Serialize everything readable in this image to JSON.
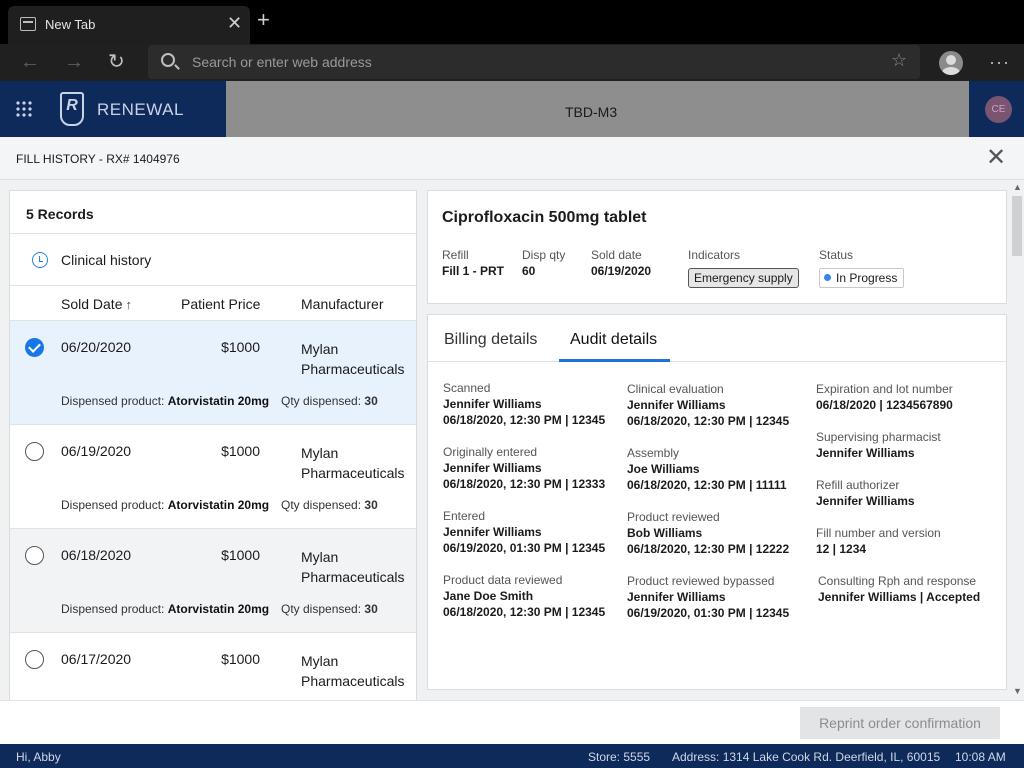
{
  "browser": {
    "tab_title": "New Tab",
    "address_placeholder": "Search or enter web address"
  },
  "app": {
    "brand": "RENEWAL",
    "logo_letter": "R",
    "store_code": "TBD-M3",
    "user_initials": "CE"
  },
  "dialog": {
    "title": "FILL HISTORY - RX# 1404976"
  },
  "left": {
    "records": "5 Records",
    "clinical_history": "Clinical history",
    "columns": {
      "sold_date": "Sold Date",
      "patient_price": "Patient Price",
      "manufacturer": "Manufacturer"
    },
    "rows": [
      {
        "date": "06/20/2020",
        "price": "$1000",
        "manufacturer": "Mylan Pharmaceuticals",
        "dispensed_label": "Dispensed product:",
        "dispensed_value": "Atorvistatin 20mg",
        "qty_label": "Qty dispensed:",
        "qty_value": "30"
      },
      {
        "date": "06/19/2020",
        "price": "$1000",
        "manufacturer": "Mylan Pharmaceuticals",
        "dispensed_label": "Dispensed product:",
        "dispensed_value": "Atorvistatin 20mg",
        "qty_label": "Qty dispensed:",
        "qty_value": "30"
      },
      {
        "date": "06/18/2020",
        "price": "$1000",
        "manufacturer": "Mylan Pharmaceuticals",
        "dispensed_label": "Dispensed product:",
        "dispensed_value": "Atorvistatin 20mg",
        "qty_label": "Qty dispensed:",
        "qty_value": "30"
      },
      {
        "date": "06/17/2020",
        "price": "$1000",
        "manufacturer": "Mylan Pharmaceuticals",
        "dispensed_label": "",
        "dispensed_value": "",
        "qty_label": "",
        "qty_value": ""
      }
    ]
  },
  "info": {
    "drug": "Ciprofloxacin 500mg tablet",
    "refill_label": "Refill",
    "refill_value": "Fill 1 - PRT",
    "disp_qty_label": "Disp qty",
    "disp_qty_value": "60",
    "sold_date_label": "Sold date",
    "sold_date_value": "06/19/2020",
    "indicators_label": "Indicators",
    "indicator": "Emergency supply",
    "status_label": "Status",
    "status": "In Progress"
  },
  "detail": {
    "tabs": [
      "Billing details",
      "Audit details"
    ],
    "fields": [
      {
        "label": "Scanned",
        "name": "Jennifer Williams",
        "value": "06/18/2020, 12:30 PM | 12345"
      },
      {
        "label": "Originally entered",
        "name": "Jennifer Williams",
        "value": "06/18/2020, 12:30 PM | 12333"
      },
      {
        "label": "Entered",
        "name": "Jennifer Williams",
        "value": "06/19/2020, 01:30 PM | 12345"
      },
      {
        "label": "Product data reviewed",
        "name": "Jane Doe Smith",
        "value": "06/18/2020, 12:30 PM | 12345"
      },
      {
        "label": "Clinical evaluation",
        "name": "Jennifer Williams",
        "value": "06/18/2020, 12:30 PM | 12345"
      },
      {
        "label": "Assembly",
        "name": "Joe Williams",
        "value": "06/18/2020, 12:30 PM | 11111"
      },
      {
        "label": "Product reviewed",
        "name": "Bob Williams",
        "value": "06/18/2020, 12:30 PM | 12222"
      },
      {
        "label": "Product reviewed bypassed",
        "name": "Jennifer Williams",
        "value": "06/19/2020, 01:30 PM | 12345"
      },
      {
        "label": "Expiration and lot number",
        "name": "06/18/2020 | 1234567890",
        "value": ""
      },
      {
        "label": "Supervising pharmacist",
        "name": "Jennifer Williams",
        "value": ""
      },
      {
        "label": "Refill authorizer",
        "name": "Jennifer Williams",
        "value": ""
      },
      {
        "label": "Fill number and version",
        "name": "12 | 1234",
        "value": ""
      },
      {
        "label": "Consulting Rph and response",
        "name": "Jennifer Williams | Accepted",
        "value": ""
      }
    ]
  },
  "footer": {
    "reprint": "Reprint order confirmation",
    "greeting": "Hi, Abby",
    "store": "Store: 5555",
    "address": "Address: 1314 Lake Cook Rd. Deerfield, IL, 60015",
    "time": "10:08 AM"
  }
}
